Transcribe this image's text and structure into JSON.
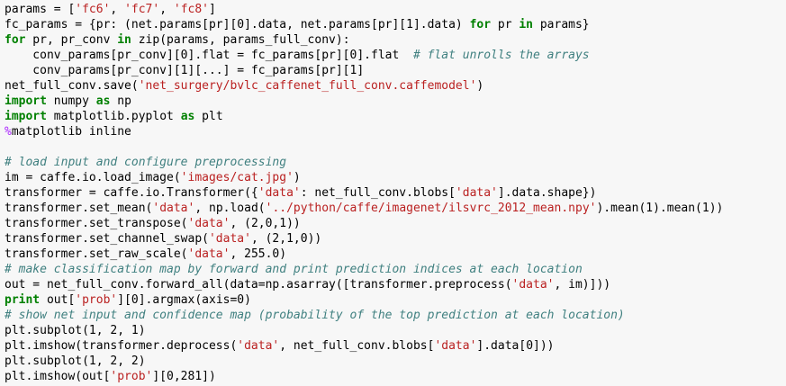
{
  "colors": {
    "background": "#f7f7f7",
    "text": "#000000",
    "keyword": "#008000",
    "string": "#ba2121",
    "comment": "#408080",
    "magic": "#aa22ff"
  },
  "code": {
    "lines": [
      [
        {
          "t": "params = [",
          "c": "tx"
        },
        {
          "t": "'fc6'",
          "c": "str"
        },
        {
          "t": ", ",
          "c": "tx"
        },
        {
          "t": "'fc7'",
          "c": "str"
        },
        {
          "t": ", ",
          "c": "tx"
        },
        {
          "t": "'fc8'",
          "c": "str"
        },
        {
          "t": "]",
          "c": "tx"
        }
      ],
      [
        {
          "t": "fc_params = {pr: (net.params[pr][0].data, net.params[pr][1].data) ",
          "c": "tx"
        },
        {
          "t": "for",
          "c": "kw"
        },
        {
          "t": " pr ",
          "c": "tx"
        },
        {
          "t": "in",
          "c": "kw"
        },
        {
          "t": " params}",
          "c": "tx"
        }
      ],
      [
        {
          "t": "for",
          "c": "kw"
        },
        {
          "t": " pr, pr_conv ",
          "c": "tx"
        },
        {
          "t": "in",
          "c": "kw"
        },
        {
          "t": " zip(params, params_full_conv):",
          "c": "tx"
        }
      ],
      [
        {
          "t": "    conv_params[pr_conv][0].flat = fc_params[pr][0].flat  ",
          "c": "tx"
        },
        {
          "t": "# flat unrolls the arrays",
          "c": "cm"
        }
      ],
      [
        {
          "t": "    conv_params[pr_conv][1][...] = fc_params[pr][1]",
          "c": "tx"
        }
      ],
      [
        {
          "t": "net_full_conv.save(",
          "c": "tx"
        },
        {
          "t": "'net_surgery/bvlc_caffenet_full_conv.caffemodel'",
          "c": "str"
        },
        {
          "t": ")",
          "c": "tx"
        }
      ],
      [
        {
          "t": "import",
          "c": "kw"
        },
        {
          "t": " numpy ",
          "c": "tx"
        },
        {
          "t": "as",
          "c": "kw"
        },
        {
          "t": " np",
          "c": "tx"
        }
      ],
      [
        {
          "t": "import",
          "c": "kw"
        },
        {
          "t": " matplotlib.pyplot ",
          "c": "tx"
        },
        {
          "t": "as",
          "c": "kw"
        },
        {
          "t": " plt",
          "c": "tx"
        }
      ],
      [
        {
          "t": "%",
          "c": "op"
        },
        {
          "t": "matplotlib inline",
          "c": "tx"
        }
      ],
      [],
      [
        {
          "t": "# load input and configure preprocessing",
          "c": "cm"
        }
      ],
      [
        {
          "t": "im = caffe.io.load_image(",
          "c": "tx"
        },
        {
          "t": "'images/cat.jpg'",
          "c": "str"
        },
        {
          "t": ")",
          "c": "tx"
        }
      ],
      [
        {
          "t": "transformer = caffe.io.Transformer({",
          "c": "tx"
        },
        {
          "t": "'data'",
          "c": "str"
        },
        {
          "t": ": net_full_conv.blobs[",
          "c": "tx"
        },
        {
          "t": "'data'",
          "c": "str"
        },
        {
          "t": "].data.shape})",
          "c": "tx"
        }
      ],
      [
        {
          "t": "transformer.set_mean(",
          "c": "tx"
        },
        {
          "t": "'data'",
          "c": "str"
        },
        {
          "t": ", np.load(",
          "c": "tx"
        },
        {
          "t": "'../python/caffe/imagenet/ilsvrc_2012_mean.npy'",
          "c": "str"
        },
        {
          "t": ").mean(1).mean(1))",
          "c": "tx"
        }
      ],
      [
        {
          "t": "transformer.set_transpose(",
          "c": "tx"
        },
        {
          "t": "'data'",
          "c": "str"
        },
        {
          "t": ", (2,0,1))",
          "c": "tx"
        }
      ],
      [
        {
          "t": "transformer.set_channel_swap(",
          "c": "tx"
        },
        {
          "t": "'data'",
          "c": "str"
        },
        {
          "t": ", (2,1,0))",
          "c": "tx"
        }
      ],
      [
        {
          "t": "transformer.set_raw_scale(",
          "c": "tx"
        },
        {
          "t": "'data'",
          "c": "str"
        },
        {
          "t": ", 255.0)",
          "c": "tx"
        }
      ],
      [
        {
          "t": "# make classification map by forward and print prediction indices at each location",
          "c": "cm"
        }
      ],
      [
        {
          "t": "out = net_full_conv.forward_all(data=np.asarray([transformer.preprocess(",
          "c": "tx"
        },
        {
          "t": "'data'",
          "c": "str"
        },
        {
          "t": ", im)]))",
          "c": "tx"
        }
      ],
      [
        {
          "t": "print",
          "c": "kw"
        },
        {
          "t": " out[",
          "c": "tx"
        },
        {
          "t": "'prob'",
          "c": "str"
        },
        {
          "t": "][0].argmax(axis=0)",
          "c": "tx"
        }
      ],
      [
        {
          "t": "# show net input and confidence map (probability of the top prediction at each location)",
          "c": "cm"
        }
      ],
      [
        {
          "t": "plt.subplot(1, 2, 1)",
          "c": "tx"
        }
      ],
      [
        {
          "t": "plt.imshow(transformer.deprocess(",
          "c": "tx"
        },
        {
          "t": "'data'",
          "c": "str"
        },
        {
          "t": ", net_full_conv.blobs[",
          "c": "tx"
        },
        {
          "t": "'data'",
          "c": "str"
        },
        {
          "t": "].data[0]))",
          "c": "tx"
        }
      ],
      [
        {
          "t": "plt.subplot(1, 2, 2)",
          "c": "tx"
        }
      ],
      [
        {
          "t": "plt.imshow(out[",
          "c": "tx"
        },
        {
          "t": "'prob'",
          "c": "str"
        },
        {
          "t": "][0,281])",
          "c": "tx"
        }
      ]
    ]
  }
}
